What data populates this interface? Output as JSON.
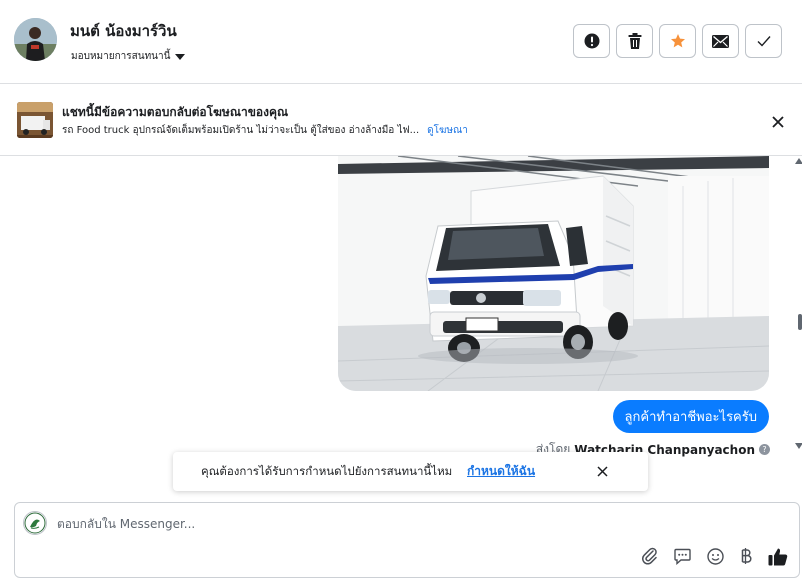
{
  "contact": {
    "name": "มนต์ น้องมาร์วิน",
    "assign_label": "มอบหมายการสนทนานี้"
  },
  "header_actions": [
    {
      "name": "spam",
      "icon": "alert-icon"
    },
    {
      "name": "delete",
      "icon": "trash-icon"
    },
    {
      "name": "star",
      "icon": "star-icon",
      "color": "#f7923b"
    },
    {
      "name": "mark-unread",
      "icon": "envelope-icon"
    },
    {
      "name": "done",
      "icon": "checkmark-icon"
    }
  ],
  "ad_reply": {
    "title": "แชทนี้มีข้อความตอบกลับต่อโฆษณาของคุณ",
    "description": "รถ Food truck อุปกรณ์จัดเต็มพร้อมเปิดร้าน ไม่ว่าจะเป็น ตู้ใส่ของ อ่างล้างมือ ไฟ...",
    "link_label": "ดูโฆษณา"
  },
  "messages": [
    {
      "type": "image",
      "alt": "white Suzuki pickup truck with box body"
    },
    {
      "type": "text",
      "text": "ลูกค้าทำอาชีพอะไรครับ",
      "color": "#0a7cff"
    }
  ],
  "sent_by": {
    "prefix": "ส่งโดย",
    "name": "Watcharin Chanpanyachon"
  },
  "toast": {
    "text": "คุณต้องการได้รับการกำหนดไปยังการสนทนานี้ไหม",
    "link_label": "กำหนดให้ฉัน"
  },
  "composer": {
    "placeholder": "ตอบกลับใน Messenger...",
    "tools": [
      "paperclip-icon",
      "saved-reply-icon",
      "emoji-icon",
      "baht-icon",
      "thumbs-up-icon"
    ]
  },
  "accent_color": "#1b74e4"
}
